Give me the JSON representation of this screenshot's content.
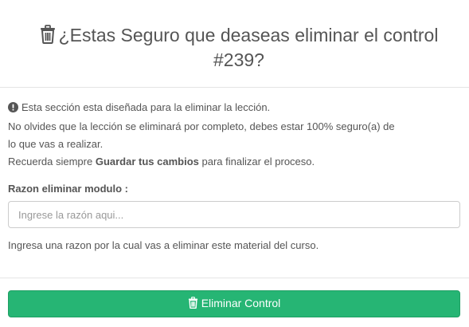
{
  "modal": {
    "title": "¿Estas Seguro que deaseas eliminar el control #239?",
    "title_icon": "trash-icon"
  },
  "info": {
    "icon": "exclamation-circle-icon",
    "line1": "Esta sección esta diseñada para la eliminar la lección.",
    "line2": "No olvides que la lección se eliminará por completo, debes estar 100% seguro(a) de",
    "line3": "lo que vas a realizar.",
    "line4_prefix": "Recuerda siempre ",
    "line4_bold": "Guardar tus cambios",
    "line4_suffix": " para finalizar el proceso."
  },
  "form": {
    "label": "Razon eliminar modulo :",
    "placeholder": "Ingrese la razón aqui...",
    "value": "",
    "help": "Ingresa una razon por la cual vas a eliminar este material del curso."
  },
  "footer": {
    "button_label": "Eliminar Control",
    "button_icon": "trash-icon",
    "button_color": "#26b574"
  }
}
